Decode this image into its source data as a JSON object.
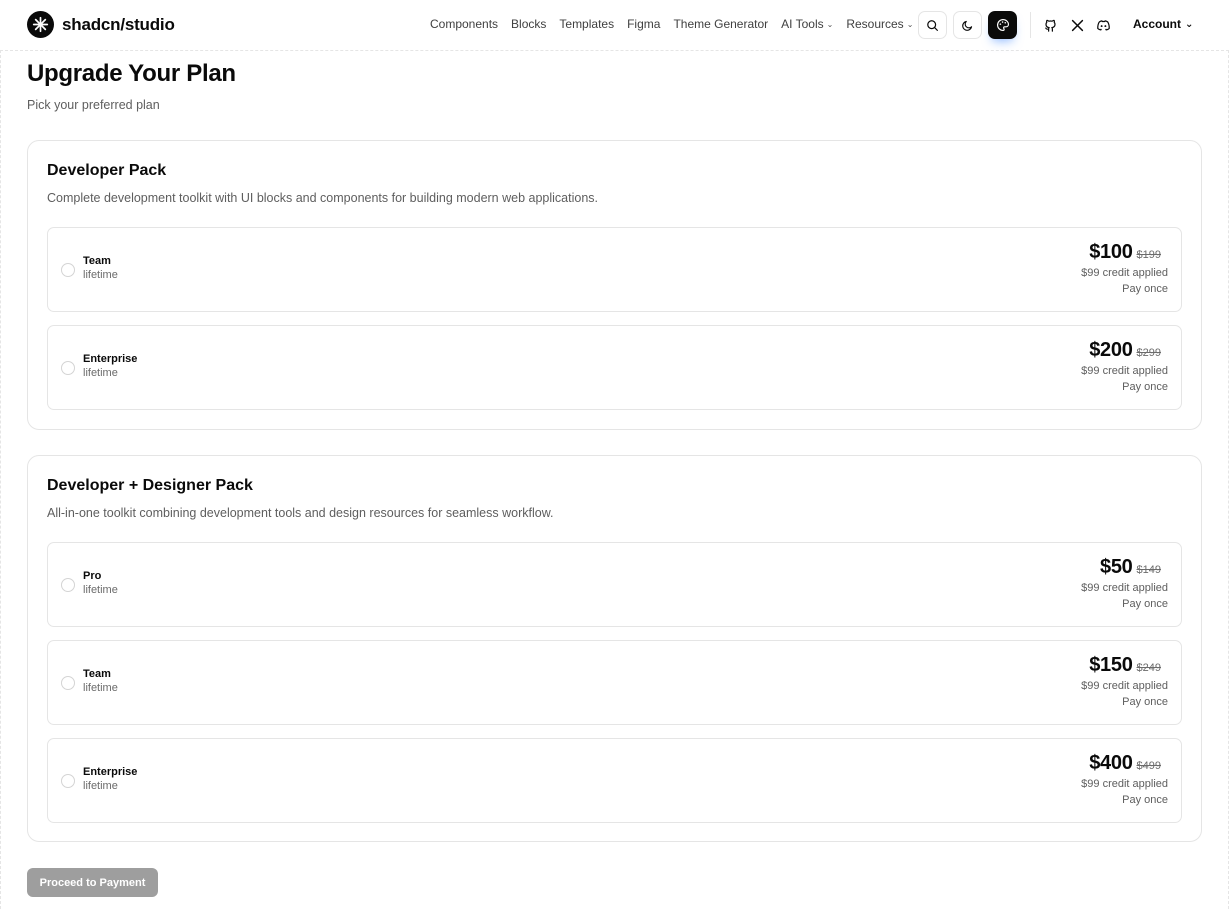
{
  "header": {
    "brand": "shadcn/studio",
    "nav": [
      {
        "label": "Components"
      },
      {
        "label": "Blocks"
      },
      {
        "label": "Templates"
      },
      {
        "label": "Figma"
      },
      {
        "label": "Theme Generator"
      },
      {
        "label": "AI Tools",
        "has_dropdown": true
      },
      {
        "label": "Resources",
        "has_dropdown": true
      }
    ],
    "icons": [
      "search-icon",
      "moon-icon",
      "palette-icon",
      "github-icon",
      "x-icon",
      "discord-icon"
    ],
    "account_label": "Account"
  },
  "page": {
    "title": "Upgrade Your Plan",
    "subtitle": "Pick your preferred plan"
  },
  "packs": [
    {
      "title": "Developer Pack",
      "description": "Complete development toolkit with UI blocks and components for building modern web applications.",
      "plans": [
        {
          "name": "Team",
          "term": "lifetime",
          "price": "$100",
          "old_price": "$199",
          "credit": "$99 credit applied",
          "note": "Pay once",
          "selected": false
        },
        {
          "name": "Enterprise",
          "term": "lifetime",
          "price": "$200",
          "old_price": "$299",
          "credit": "$99 credit applied",
          "note": "Pay once",
          "selected": false
        }
      ]
    },
    {
      "title": "Developer + Designer Pack",
      "description": "All-in-one toolkit combining development tools and design resources for seamless workflow.",
      "plans": [
        {
          "name": "Pro",
          "term": "lifetime",
          "price": "$50",
          "old_price": "$149",
          "credit": "$99 credit applied",
          "note": "Pay once",
          "selected": false
        },
        {
          "name": "Team",
          "term": "lifetime",
          "price": "$150",
          "old_price": "$249",
          "credit": "$99 credit applied",
          "note": "Pay once",
          "selected": false
        },
        {
          "name": "Enterprise",
          "term": "lifetime",
          "price": "$400",
          "old_price": "$499",
          "credit": "$99 credit applied",
          "note": "Pay once",
          "selected": false
        }
      ]
    }
  ],
  "actions": {
    "proceed_label": "Proceed to Payment",
    "proceed_disabled": true
  },
  "colors": {
    "primary": "#0a0a0a",
    "muted_text": "#5e5e5e",
    "border": "#e5e5e5",
    "disabled_button": "#9e9e9e"
  }
}
